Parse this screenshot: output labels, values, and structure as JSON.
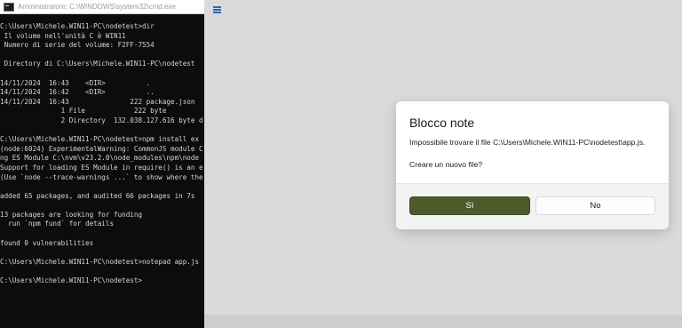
{
  "cmd": {
    "title": "Amministratore: C:\\WINDOWS\\system32\\cmd.exe",
    "lines": [
      "C:\\Users\\Michele.WIN11-PC\\nodetest>dir",
      " Il volume nell'unità C è WIN11",
      " Numero di serie del volume: F2FF-7554",
      "",
      " Directory di C:\\Users\\Michele.WIN11-PC\\nodetest",
      "",
      "14/11/2024  16:43    <DIR>          .",
      "14/11/2024  16:42    <DIR>          ..",
      "14/11/2024  16:43               222 package.json",
      "               1 File            222 byte",
      "               2 Directory  132.038.127.616 byte d",
      "",
      "C:\\Users\\Michele.WIN11-PC\\nodetest>npm install ex",
      "(node:6024) ExperimentalWarning: CommonJS module C",
      "ng ES Module C:\\nvm\\v23.2.0\\node_modules\\npm\\node",
      "Support for loading ES Module in require() is an e",
      "(Use `node --trace-warnings ...` to show where the",
      "",
      "added 65 packages, and audited 66 packages in 7s",
      "",
      "13 packages are looking for funding",
      "  run `npm fund` for details",
      "",
      "found 0 vulnerabilities",
      "",
      "C:\\Users\\Michele.WIN11-PC\\nodetest>notepad app.js",
      "",
      "C:\\Users\\Michele.WIN11-PC\\nodetest>"
    ]
  },
  "dialog": {
    "title": "Blocco note",
    "message": "Impossibile trovare il file C:\\Users\\Michele.WIN11-PC\\nodetest\\app.js.",
    "question": "Creare un nuovo file?",
    "yes_label": "Sì",
    "no_label": "No"
  },
  "colors": {
    "primary_button": "#4d5a29",
    "terminal_bg": "#0c0c0c",
    "terminal_text": "#d6d6d6"
  }
}
